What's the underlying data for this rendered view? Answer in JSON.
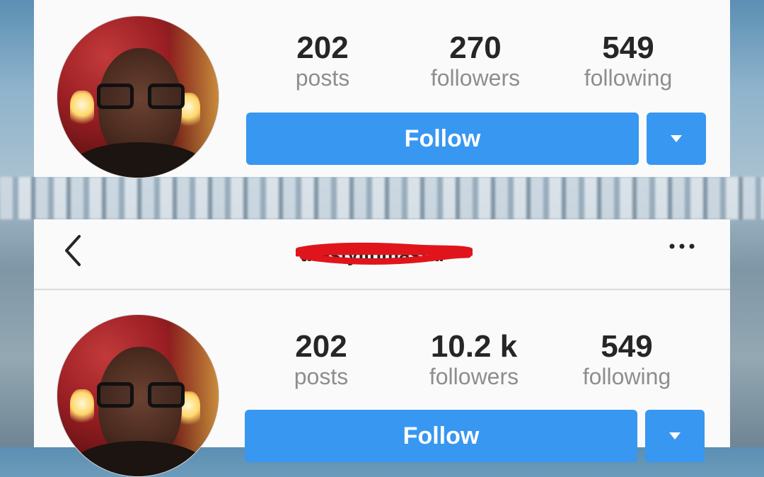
{
  "profiles": [
    {
      "stats": [
        {
          "value": "202",
          "label": "posts"
        },
        {
          "value": "270",
          "label": "followers"
        },
        {
          "value": "549",
          "label": "following"
        }
      ],
      "follow_label": "Follow"
    },
    {
      "header": {
        "username": "thestylinmastar"
      },
      "stats": [
        {
          "value": "202",
          "label": "posts"
        },
        {
          "value": "10.2 k",
          "label": "followers"
        },
        {
          "value": "549",
          "label": "following"
        }
      ],
      "follow_label": "Follow"
    }
  ],
  "colors": {
    "accent": "#3897f0",
    "scribble": "#e0151b"
  },
  "icons": {
    "back": "chevron-left-icon",
    "more": "more-horizontal-icon",
    "dropdown": "triangle-down-icon"
  }
}
